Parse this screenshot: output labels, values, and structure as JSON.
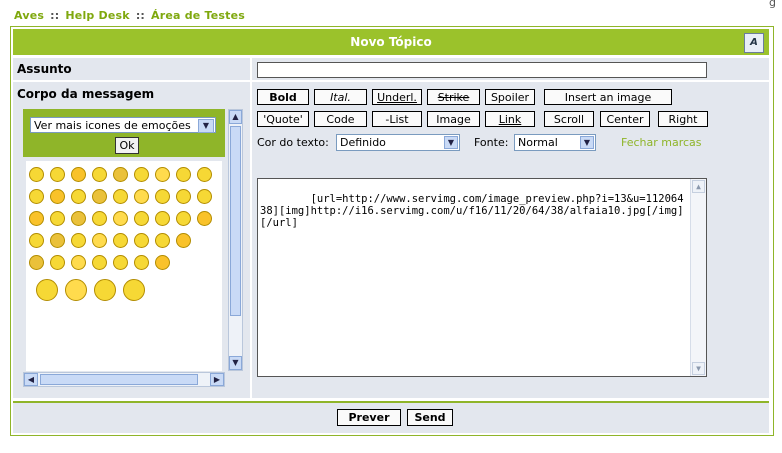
{
  "breadcrumb": {
    "items": [
      "Aves",
      "Help Desk",
      "Área de Testes"
    ],
    "separator": "::"
  },
  "corner_text": "g",
  "form": {
    "title": "Novo Tópico",
    "font_size_button": "A",
    "subject_label": "Assunto",
    "subject_value": "",
    "body_label": "Corpo da messagem"
  },
  "emoticons": {
    "select_value": "Ver mais icones de emoções",
    "ok_label": "Ok",
    "count": 46
  },
  "toolbar": {
    "row1": [
      "Bold",
      "Ital.",
      "Underl.",
      "Strike",
      "Spoiler",
      "Insert an image"
    ],
    "row2": [
      "'Quote'",
      "Code",
      "-List",
      "Image",
      "Link",
      "Scroll",
      "Center",
      "Right"
    ],
    "color_label": "Cor do texto:",
    "color_value": "Definido",
    "font_label": "Fonte:",
    "font_value": "Normal",
    "close_tags": "Fechar marcas"
  },
  "message": {
    "text": "[url=http://www.servimg.com/image_preview.php?i=13&u=11206438][img]http://i16.servimg.com/u/f16/11/20/64/38/alfaia10.jpg[/img][/url]"
  },
  "footer": {
    "preview_label": "Prever",
    "send_label": "Send"
  },
  "colors": {
    "accent": "#9bc22b",
    "panel": "#e3e7ee",
    "link": "#7fa80e"
  }
}
